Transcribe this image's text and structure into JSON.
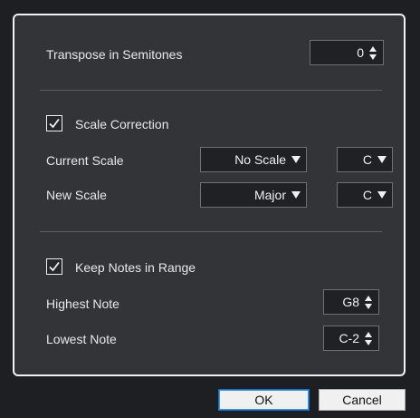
{
  "transpose": {
    "label": "Transpose in Semitones",
    "value": "0"
  },
  "scale_correction": {
    "label": "Scale Correction",
    "checked": true,
    "current_scale": {
      "label": "Current Scale",
      "scale": "No Scale",
      "root": "C"
    },
    "new_scale": {
      "label": "New Scale",
      "scale": "Major",
      "root": "C"
    }
  },
  "keep_notes": {
    "label": "Keep Notes in Range",
    "checked": true,
    "highest": {
      "label": "Highest Note",
      "value": "G8"
    },
    "lowest": {
      "label": "Lowest Note",
      "value": "C-2"
    }
  },
  "buttons": {
    "ok": "OK",
    "cancel": "Cancel"
  },
  "icons": {
    "spin": "spin-arrows-icon",
    "dropdown": "dropdown-arrow-icon",
    "check": "checkmark-icon"
  }
}
